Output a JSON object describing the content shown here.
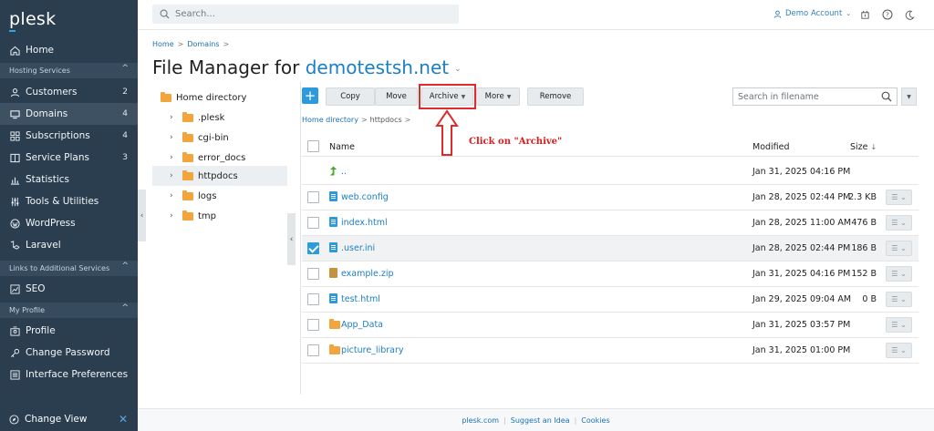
{
  "sidebar": {
    "logo": "plesk",
    "items": [
      {
        "label": "Home",
        "icon": "home-icon"
      },
      {
        "label": "Customers",
        "icon": "user-icon",
        "count": "2"
      },
      {
        "label": "Domains",
        "icon": "monitor-icon",
        "count": "4"
      },
      {
        "label": "Subscriptions",
        "icon": "grid-icon",
        "count": "4"
      },
      {
        "label": "Service Plans",
        "icon": "book-icon",
        "count": "3"
      },
      {
        "label": "Statistics",
        "icon": "chart-icon"
      },
      {
        "label": "Tools & Utilities",
        "icon": "sliders-icon"
      },
      {
        "label": "WordPress",
        "icon": "wordpress-icon"
      },
      {
        "label": "Laravel",
        "icon": "laravel-icon"
      },
      {
        "label": "SEO",
        "icon": "seo-icon"
      },
      {
        "label": "Profile",
        "icon": "profile-icon"
      },
      {
        "label": "Change Password",
        "icon": "key-icon"
      },
      {
        "label": "Interface Preferences",
        "icon": "prefs-icon"
      }
    ],
    "sections": [
      "Hosting Services",
      "Links to Additional Services",
      "My Profile"
    ],
    "change_view": "Change View"
  },
  "topbar": {
    "search_placeholder": "Search...",
    "account": "Demo Account"
  },
  "breadcrumb": {
    "home": "Home",
    "domains": "Domains"
  },
  "title": {
    "prefix": "File Manager for",
    "domain": "demotestsh.net"
  },
  "tree": {
    "root": "Home directory",
    "items": [
      ".plesk",
      "cgi-bin",
      "error_docs",
      "httpdocs",
      "logs",
      "tmp"
    ]
  },
  "toolbar": {
    "copy": "Copy",
    "move": "Move",
    "archive": "Archive",
    "more": "More",
    "remove": "Remove",
    "search_placeholder": "Search in filename"
  },
  "file_crumb": {
    "root": "Home directory",
    "current": "httpdocs"
  },
  "annotation": "Click on \"Archive\"",
  "table": {
    "headers": {
      "name": "Name",
      "modified": "Modified",
      "size": "Size"
    },
    "rows": [
      {
        "name": "..",
        "modified": "Jan 31, 2025 04:16 PM",
        "size": ""
      },
      {
        "name": "web.config",
        "modified": "Jan 28, 2025 02:44 PM",
        "size": "2.3 KB"
      },
      {
        "name": "index.html",
        "modified": "Jan 28, 2025 11:00 AM",
        "size": "476 B"
      },
      {
        "name": ".user.ini",
        "modified": "Jan 28, 2025 02:44 PM",
        "size": "186 B"
      },
      {
        "name": "example.zip",
        "modified": "Jan 31, 2025 04:16 PM",
        "size": "152 B"
      },
      {
        "name": "test.html",
        "modified": "Jan 29, 2025 09:04 AM",
        "size": "0 B"
      },
      {
        "name": "App_Data",
        "modified": "Jan 31, 2025 03:57 PM",
        "size": ""
      },
      {
        "name": "picture_library",
        "modified": "Jan 31, 2025 01:00 PM",
        "size": ""
      }
    ]
  },
  "footer": {
    "links": [
      "plesk.com",
      "Suggest an Idea",
      "Cookies"
    ]
  }
}
